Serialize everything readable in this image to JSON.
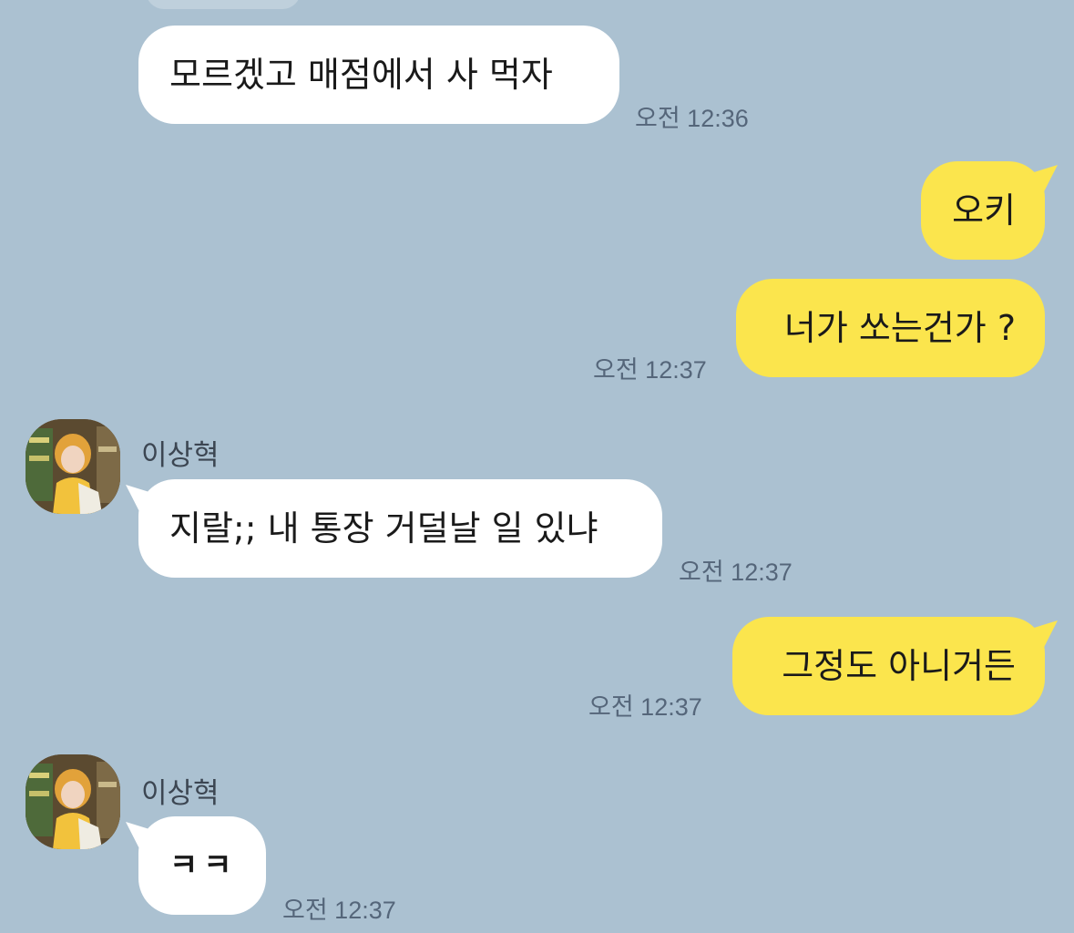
{
  "conversation": {
    "sender_name": "이상혁",
    "messages": [
      {
        "side": "in",
        "text": "모르겠고 매점에서 사 먹자",
        "time": "오전 12:36"
      },
      {
        "side": "out",
        "text": "오키",
        "time": ""
      },
      {
        "side": "out",
        "text": "너가 쏘는건가 ?",
        "time": "오전 12:37"
      },
      {
        "side": "in",
        "sender": "이상혁",
        "text": "지랄;; 내 통장 거덜날 일 있냐",
        "time": "오전 12:37"
      },
      {
        "side": "out",
        "text": "그정도 아니거든",
        "time": "오전 12:37"
      },
      {
        "side": "in",
        "sender": "이상혁",
        "text": "ㅋㅋ",
        "time": "오전 12:37"
      }
    ]
  },
  "colors": {
    "background": "#abc1d1",
    "incoming_bubble": "#ffffff",
    "outgoing_bubble": "#fbe54d",
    "timestamp": "#55667a"
  },
  "icons": {
    "avatar": "profile-photo-avatar"
  }
}
